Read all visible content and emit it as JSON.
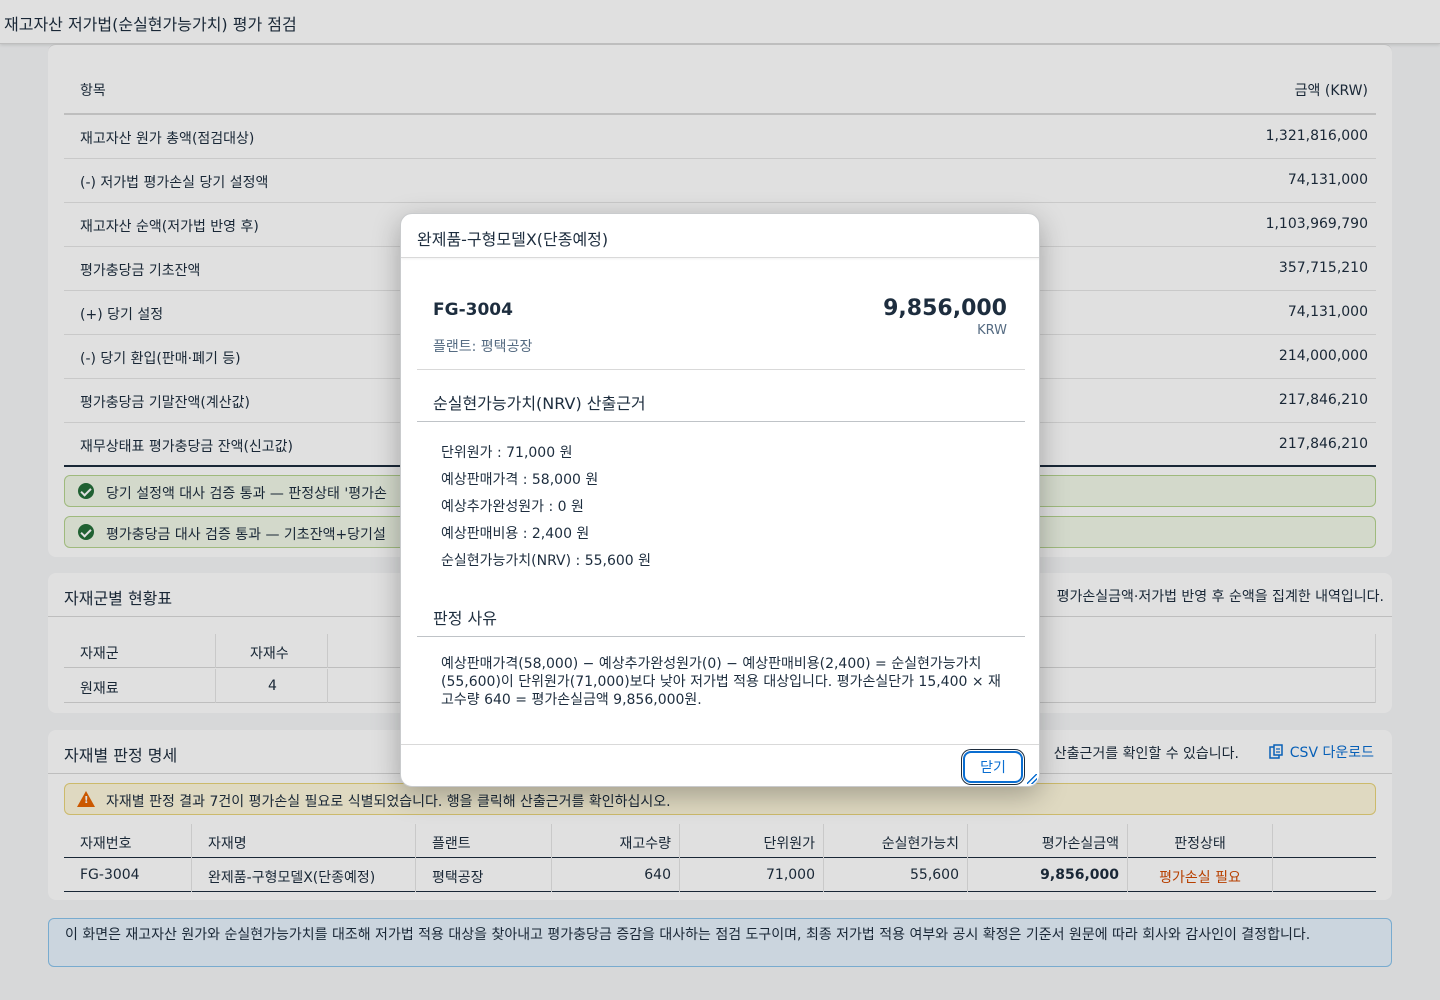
{
  "page": {
    "title": "재고자산 저가법(순실현가능가치) 평가 점검"
  },
  "summary": {
    "col_item": "항목",
    "col_amount": "금액 (KRW)",
    "rows": [
      {
        "label": "재고자산 원가 총액(점검대상)",
        "amount": "1,321,816,000"
      },
      {
        "label": "(-) 저가법 평가손실 당기 설정액",
        "amount": "74,131,000"
      },
      {
        "label": "재고자산 순액(저가법 반영 후)",
        "amount": "1,103,969,790"
      },
      {
        "label": "평가충당금 기초잔액",
        "amount": "357,715,210"
      },
      {
        "label": "(+) 당기 설정",
        "amount": "74,131,000"
      },
      {
        "label": "(-) 당기 환입(판매·폐기 등)",
        "amount": "214,000,000"
      },
      {
        "label": "평가충당금 기말잔액(계산값)",
        "amount": "217,846,210"
      },
      {
        "label": "재무상태표 평가충당금 잔액(신고값)",
        "amount": "217,846,210"
      }
    ],
    "checks": [
      {
        "text": "당기 설정액 대사 검증 통과 — 판정상태 '평가손"
      },
      {
        "text": "평가충당금 대사 검증 통과 — 기초잔액+당기설"
      }
    ]
  },
  "group_table": {
    "title": "자재군별 현황표",
    "description": "평가손실금액·저가법 반영 후 순액을 집계한 내역입니다.",
    "headers": [
      "자재군",
      "자재수"
    ],
    "rows": [
      {
        "group": "원재료",
        "count": "4"
      }
    ]
  },
  "detail_table": {
    "title": "자재별 판정 명세",
    "description": "산출근거를 확인할 수 있습니다.",
    "csv_label": "CSV 다운로드",
    "warning": "자재별 판정 결과 7건이 평가손실 필요로 식별되었습니다. 행을 클릭해 산출근거를 확인하십시오.",
    "headers": [
      "자재번호",
      "자재명",
      "플랜트",
      "재고수량",
      "단위원가",
      "순실현가능치",
      "평가손실금액",
      "판정상태"
    ],
    "rows": [
      {
        "code": "FG-3004",
        "name": "완제품-구형모델X(단종예정)",
        "plant": "평택공장",
        "qty": "640",
        "unit_cost": "71,000",
        "nrv": "55,600",
        "loss": "9,856,000",
        "status": "평가손실 필요"
      }
    ]
  },
  "info_notice": "이 화면은 재고자산 원가와 순실현가능가치를 대조해 저가법 적용 대상을 찾아내고 평가충당금 증감을 대사하는 점검 도구이며, 최종 저가법 적용 여부와 공시 확정은 기준서 원문에 따라 회사와 감사인이 결정합니다.",
  "dialog": {
    "title": "완제품-구형모델X(단종예정)",
    "code": "FG-3004",
    "plant": "플랜트: 평택공장",
    "amount": "9,856,000",
    "currency": "KRW",
    "nrv_title": "순실현가능가치(NRV) 산출근거",
    "nrv_lines": [
      "단위원가 : 71,000 원",
      "예상판매가격 : 58,000 원",
      "예상추가완성원가 : 0 원",
      "예상판매비용 : 2,400 원",
      "순실현가능가치(NRV) : 55,600 원"
    ],
    "reason_title": "판정 사유",
    "reason_text": "예상판매가격(58,000) − 예상추가완성원가(0) − 예상판매비용(2,400) = 순실현가능가치(55,600)이 단위원가(71,000)보다 낮아 저가법 적용 대상입니다. 평가손실단가 15,400 × 재고수량 640 = 평가손실금액 9,856,000원.",
    "close_label": "닫기"
  },
  "colors": {
    "accent": "#0a6ed1",
    "success": "#256f3a",
    "warning": "#e76500",
    "loss_status": "#d14900"
  }
}
